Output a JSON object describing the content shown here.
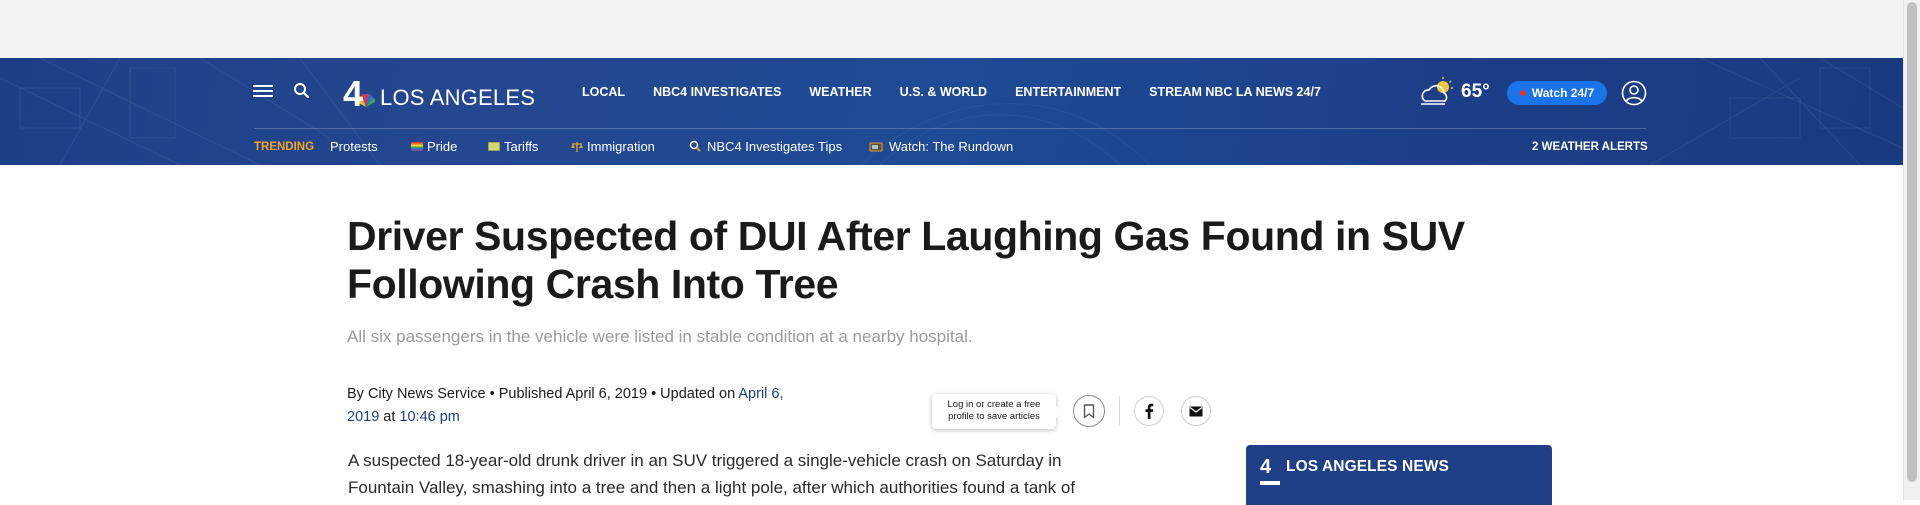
{
  "header": {
    "logo_text": "LOS ANGELES",
    "nav": [
      "LOCAL",
      "NBC4 INVESTIGATES",
      "WEATHER",
      "U.S. & WORLD",
      "ENTERTAINMENT",
      "STREAM NBC LA NEWS 24/7"
    ],
    "weather_temp": "65°",
    "watch_label": "Watch 24/7",
    "trending_label": "TRENDING",
    "trending": [
      {
        "label": "Protests",
        "icon": ""
      },
      {
        "label": "Pride",
        "icon": "rainbow-flag-icon"
      },
      {
        "label": "Tariffs",
        "icon": "money-icon"
      },
      {
        "label": "Immigration",
        "icon": "scales-icon"
      },
      {
        "label": "NBC4 Investigates Tips",
        "icon": "magnifier-icon"
      },
      {
        "label": "Watch: The Rundown",
        "icon": "tv-icon"
      }
    ],
    "alerts": "2 WEATHER ALERTS"
  },
  "article": {
    "title": "Driver Suspected of DUI After Laughing Gas Found in SUV Following Crash Into Tree",
    "subtitle": "All six passengers in the vehicle were listed in stable condition at a nearby hospital.",
    "byline_prefix": "By City News Service • Published April 6, 2019 • Updated on ",
    "updated_date": "April 6, 2019",
    "byline_at": " at ",
    "updated_time": "10:46 pm",
    "save_tooltip": "Log in or create a free profile to save articles",
    "body": "A suspected 18-year-old drunk driver in an SUV triggered a single-vehicle crash on Saturday in Fountain Valley, smashing into a tree and then a light pole, after which authorities found a tank of"
  },
  "sidebar": {
    "card_logo": "4",
    "card_title": "LOS ANGELES NEWS"
  },
  "colors": {
    "header_blue": "#1f4a95",
    "trending_orange": "#f5a623",
    "watch_blue": "#1a73e8",
    "link_blue": "#1a3d87"
  }
}
